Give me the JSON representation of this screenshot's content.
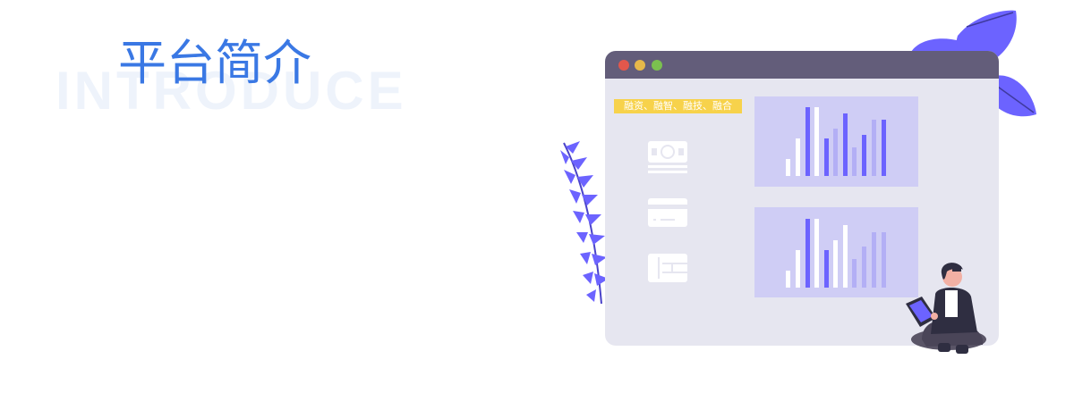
{
  "heading": {
    "background_word": "INTRODUCE",
    "title": "平台简介"
  },
  "illustration": {
    "tag": "融资、融智、融技、融合",
    "colors": {
      "accent": "#6c63ff",
      "title": "#3a78e4",
      "window_bar": "#635d7a",
      "window_body": "#e6e6f0",
      "chart_panel": "#cfcdf5",
      "tag_bg": "#f7d24b"
    }
  }
}
